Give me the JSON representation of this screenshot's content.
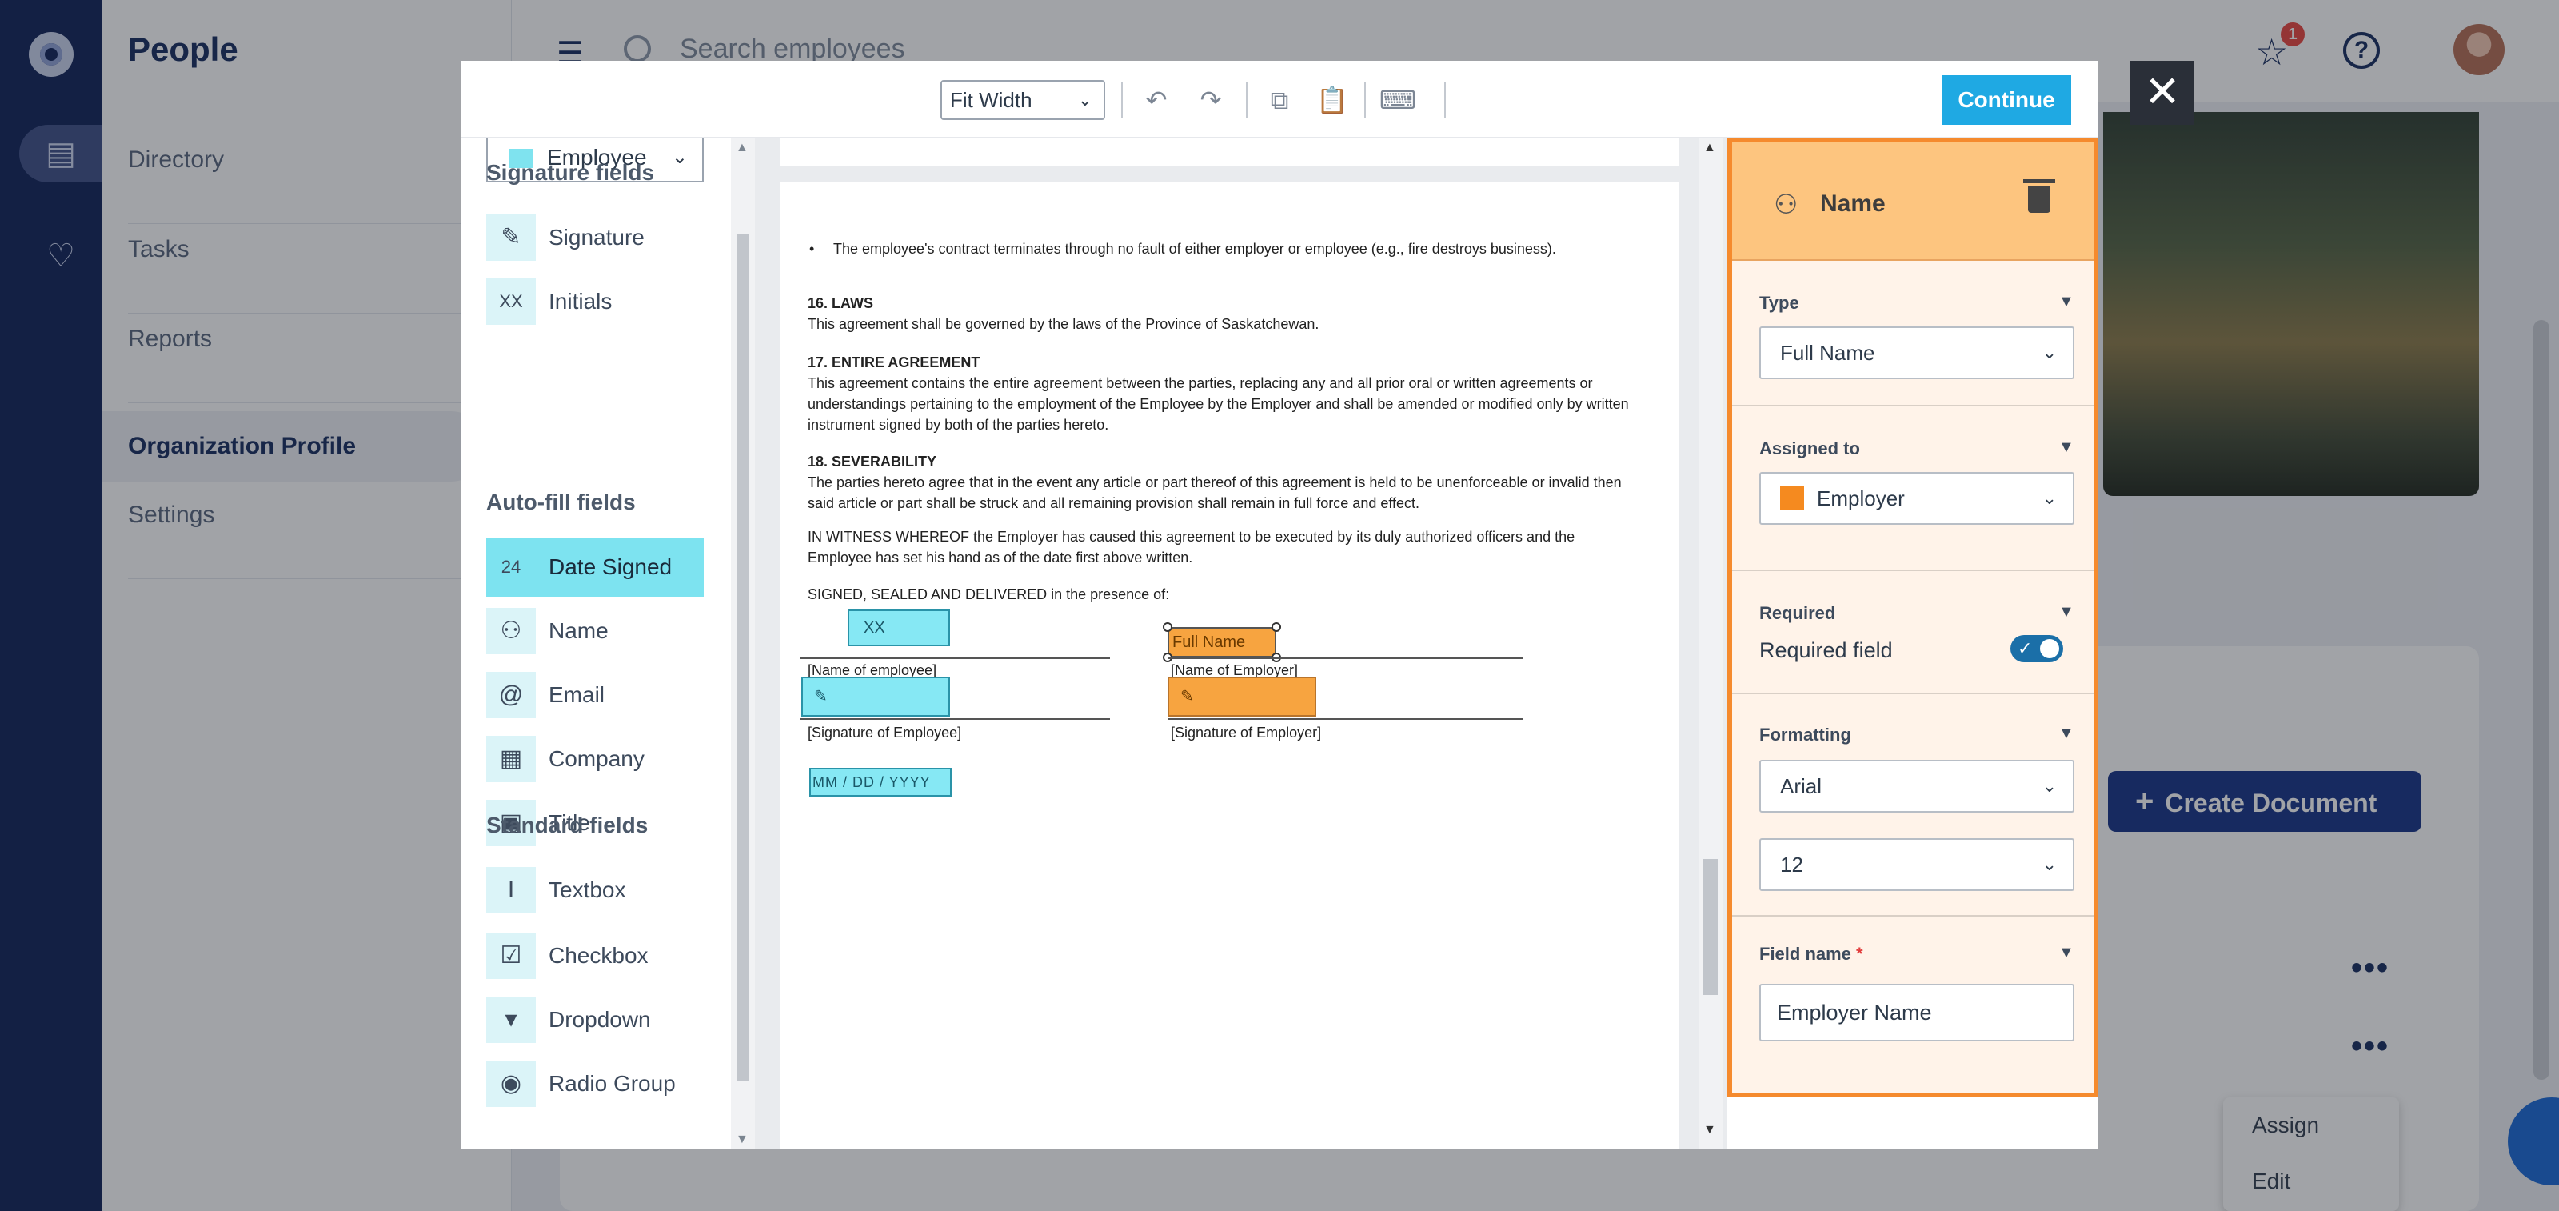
{
  "app": {
    "title": "People",
    "nav": [
      "Directory",
      "Tasks",
      "Reports",
      "Organization Profile",
      "Settings"
    ],
    "search_placeholder": "Search employees",
    "notification_count": "1",
    "help_label": "?",
    "create_document_label": "Create Document",
    "more_label": "•••",
    "context_menu": [
      "Assign",
      "Edit"
    ]
  },
  "toolbar": {
    "zoom": "Fit Width",
    "continue_label": "Continue"
  },
  "palette": {
    "assignee": "Employee",
    "assignee_color": "#7fe3ef",
    "sections": [
      {
        "title": "Signature fields",
        "items": [
          {
            "label": "Signature",
            "icon": "pen-icon",
            "glyph": "✎"
          },
          {
            "label": "Initials",
            "icon": "initials-icon",
            "glyph": "XX"
          }
        ]
      },
      {
        "title": "Auto-fill fields",
        "items": [
          {
            "label": "Date Signed",
            "icon": "calendar-icon",
            "glyph": "24",
            "selected": true
          },
          {
            "label": "Name",
            "icon": "person-icon",
            "glyph": "⚇"
          },
          {
            "label": "Email",
            "icon": "at-icon",
            "glyph": "@"
          },
          {
            "label": "Company",
            "icon": "building-icon",
            "glyph": "▦"
          },
          {
            "label": "Title",
            "icon": "briefcase-icon",
            "glyph": "▣"
          }
        ]
      },
      {
        "title": "Standard fields",
        "items": [
          {
            "label": "Textbox",
            "icon": "textbox-icon",
            "glyph": "I"
          },
          {
            "label": "Checkbox",
            "icon": "checkbox-icon",
            "glyph": "☑"
          },
          {
            "label": "Dropdown",
            "icon": "dropdown-icon",
            "glyph": "▾"
          },
          {
            "label": "Radio Group",
            "icon": "radio-icon",
            "glyph": "◉"
          }
        ]
      }
    ]
  },
  "document": {
    "bullet": "The employee's contract terminates through no fault of either employer or employee (e.g., fire destroys business).",
    "s16_title": "16. LAWS",
    "s16_body": "This agreement shall be governed by the laws of the Province of Saskatchewan.",
    "s17_title": "17. ENTIRE AGREEMENT",
    "s17_body": "This agreement contains the entire agreement between the parties, replacing any and all prior oral or written agreements or understandings pertaining to the employment of the Employee by the Employer and shall be amended or modified only by written instrument signed by both of the parties hereto.",
    "s18_title": "18. SEVERABILITY",
    "s18_body": "The parties hereto agree that in the event any article or part thereof of this agreement is held to be unenforceable or invalid then said article or part shall be struck and all remaining provision shall remain in full force and effect.",
    "witness": "IN WITNESS WHEREOF the Employer has caused this agreement to be executed by its duly authorized officers and the Employee has set his hand as of the date first above written.",
    "signed": "SIGNED, SEALED AND DELIVERED in the presence of:",
    "cap_name_employee": "[Name of employee]",
    "cap_name_employer": "[Name of Employer]",
    "cap_sig_employee": "[Signature of Employee]",
    "cap_sig_employer": "[Signature of Employer]",
    "field_initials": "XX",
    "field_fullname": "Full Name",
    "field_date": "MM / DD / YYYY",
    "field_sig_glyph": "✎"
  },
  "props": {
    "title": "Name",
    "type_label": "Type",
    "type_value": "Full Name",
    "assigned_label": "Assigned to",
    "assigned_value": "Employer",
    "assigned_color": "#f58a1f",
    "required_label": "Required",
    "required_toggle_label": "Required field",
    "required_on": true,
    "formatting_label": "Formatting",
    "font_value": "Arial",
    "size_value": "12",
    "fieldname_label": "Field name",
    "fieldname_req": "*",
    "fieldname_value": "Employer Name"
  }
}
